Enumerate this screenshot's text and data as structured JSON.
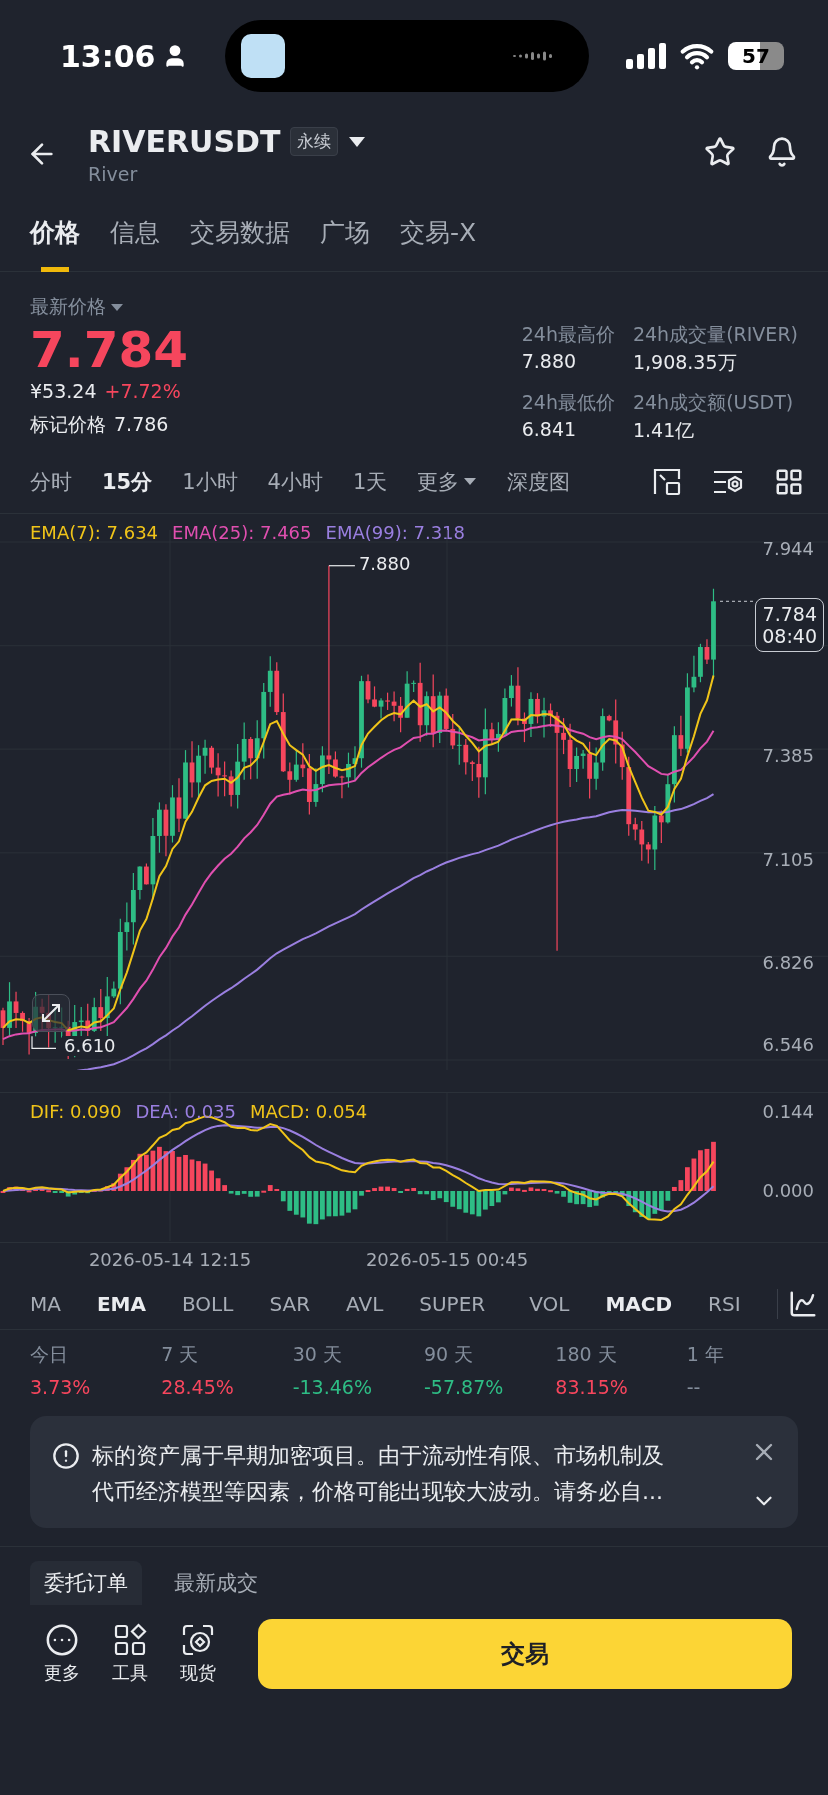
{
  "status_bar": {
    "time": "13:06",
    "battery": "57"
  },
  "header": {
    "symbol": "RIVERUSDT",
    "badge": "永续",
    "name": "River"
  },
  "tabs": [
    {
      "label": "价格",
      "selected": true
    },
    {
      "label": "信息",
      "selected": false
    },
    {
      "label": "交易数据",
      "selected": false
    },
    {
      "label": "广场",
      "selected": false
    },
    {
      "label": "交易-X",
      "selected": false
    }
  ],
  "price": {
    "label": "最新价格",
    "last": "7.784",
    "cny": "¥53.24",
    "change": "+7.72%",
    "mark_label": "标记价格",
    "mark_value": "7.786"
  },
  "stats": [
    {
      "label": "24h最高价",
      "value": "7.880"
    },
    {
      "label": "24h成交量(RIVER)",
      "value": "1,908.35万"
    },
    {
      "label": "24h最低价",
      "value": "6.841"
    },
    {
      "label": "24h成交额(USDT)",
      "value": "1.41亿"
    }
  ],
  "intervals": [
    {
      "label": "分时",
      "selected": false,
      "kind": "plain"
    },
    {
      "label": "15分",
      "selected": true,
      "kind": "plain"
    },
    {
      "label": "1小时",
      "selected": false,
      "kind": "plain"
    },
    {
      "label": "4小时",
      "selected": false,
      "kind": "plain"
    },
    {
      "label": "1天",
      "selected": false,
      "kind": "plain"
    },
    {
      "label": "更多",
      "selected": false,
      "kind": "dropdown"
    },
    {
      "label": "深度图",
      "selected": false,
      "kind": "plain"
    }
  ],
  "chart": {
    "legend": [
      {
        "text": "EMA(7): 7.634",
        "color": "#f0c419"
      },
      {
        "text": "EMA(25): 7.465",
        "color": "#e04fb0"
      },
      {
        "text": "EMA(99): 7.318",
        "color": "#9a7fe0"
      }
    ],
    "price_axis": [
      "7.944",
      "7.385",
      "7.105",
      "6.826",
      "6.546"
    ],
    "high_marker": "7.880",
    "low_marker": "6.610",
    "current_price": "7.784",
    "countdown": "08:40"
  },
  "macd": {
    "legend": [
      {
        "text": "DIF: 0.090",
        "color": "#f0c419"
      },
      {
        "text": "DEA: 0.035",
        "color": "#9a7fe0"
      },
      {
        "text": "MACD: 0.054",
        "color": "#f0c419"
      }
    ],
    "axis": [
      "0.144",
      "0.000"
    ]
  },
  "time_axis": [
    "2026-05-14 12:15",
    "2026-05-15 00:45"
  ],
  "main_indicators": [
    {
      "label": "MA",
      "selected": false
    },
    {
      "label": "EMA",
      "selected": true
    },
    {
      "label": "BOLL",
      "selected": false
    },
    {
      "label": "SAR",
      "selected": false
    },
    {
      "label": "AVL",
      "selected": false
    },
    {
      "label": "SUPER",
      "selected": false
    }
  ],
  "sub_indicators": [
    {
      "label": "VOL",
      "selected": false
    },
    {
      "label": "MACD",
      "selected": true
    },
    {
      "label": "RSI",
      "selected": false
    }
  ],
  "performance": [
    {
      "period": "今日",
      "value": "3.73%",
      "color": "#f6465d"
    },
    {
      "period": "7 天",
      "value": "28.45%",
      "color": "#f6465d"
    },
    {
      "period": "30 天",
      "value": "-13.46%",
      "color": "#2ebd85"
    },
    {
      "period": "90 天",
      "value": "-57.87%",
      "color": "#2ebd85"
    },
    {
      "period": "180 天",
      "value": "83.15%",
      "color": "#f6465d"
    },
    {
      "period": "1 年",
      "value": "--",
      "color": "#848e9c"
    }
  ],
  "notice": {
    "text": "标的资产属于早期加密项目。由于流动性有限、市场机制及代币经济模型等因素，价格可能出现较大波动。请务必自..."
  },
  "order_tabs": [
    {
      "label": "委托订单",
      "selected": true
    },
    {
      "label": "最新成交",
      "selected": false
    }
  ],
  "bottom_actions": [
    {
      "label": "更多",
      "kind": "more"
    },
    {
      "label": "工具",
      "kind": "tools"
    },
    {
      "label": "现货",
      "kind": "spot"
    }
  ],
  "trade_button": "交易"
}
